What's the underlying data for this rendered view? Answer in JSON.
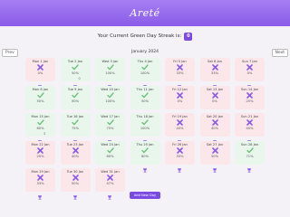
{
  "app": {
    "title": "Areté"
  },
  "streak": {
    "label": "Your Current Green Day Streak is:",
    "count": "0"
  },
  "nav": {
    "prev": "Prev",
    "next": "Next",
    "month": "January 2024"
  },
  "days": [
    {
      "date": "Mon 1 Jan",
      "status": "red",
      "pct": "0%",
      "cup": true,
      "cups": ""
    },
    {
      "date": "Tue 2 Jan",
      "status": "green",
      "pct": "50%",
      "cup": true,
      "cups": "0"
    },
    {
      "date": "Wed 3 Jan",
      "status": "green",
      "pct": "100%",
      "cup": true,
      "cups": ""
    },
    {
      "date": "Thu 4 Jan",
      "status": "green",
      "pct": "100%",
      "cup": true,
      "cups": ""
    },
    {
      "date": "Fri 5 Jan",
      "status": "red",
      "pct": "33%",
      "cup": true,
      "cups": ""
    },
    {
      "date": "Sat 6 Jan",
      "status": "red",
      "pct": "33%",
      "cup": true,
      "cups": ""
    },
    {
      "date": "Sun 7 Jan",
      "status": "red",
      "pct": "0%",
      "cup": true,
      "cups": ""
    },
    {
      "date": "Mon 8 Jan",
      "status": "green",
      "pct": "50%",
      "cup": true,
      "cups": ""
    },
    {
      "date": "Tue 9 Jan",
      "status": "green",
      "pct": "50%",
      "cup": true,
      "cups": ""
    },
    {
      "date": "Wed 10 Jan",
      "status": "green",
      "pct": "100%",
      "cup": true,
      "cups": ""
    },
    {
      "date": "Thu 11 Jan",
      "status": "green",
      "pct": "50%",
      "cup": true,
      "cups": ""
    },
    {
      "date": "Fri 12 Jan",
      "status": "red",
      "pct": "0%",
      "cup": true,
      "cups": ""
    },
    {
      "date": "Sat 13 Jan",
      "status": "red",
      "pct": "0%",
      "cup": true,
      "cups": ""
    },
    {
      "date": "Sun 14 Jan",
      "status": "red",
      "pct": "25%",
      "cup": true,
      "cups": ""
    },
    {
      "date": "Mon 15 Jan",
      "status": "green",
      "pct": "60%",
      "cup": true,
      "cups": "3"
    },
    {
      "date": "Tue 16 Jan",
      "status": "green",
      "pct": "75%",
      "cup": true,
      "cups": ""
    },
    {
      "date": "Wed 17 Jan",
      "status": "green",
      "pct": "75%",
      "cup": true,
      "cups": ""
    },
    {
      "date": "Thu 18 Jan",
      "status": "green",
      "pct": "100%",
      "cup": true,
      "cups": ""
    },
    {
      "date": "Fri 19 Jan",
      "status": "red",
      "pct": "40%",
      "cup": true,
      "cups": ""
    },
    {
      "date": "Sat 20 Jan",
      "status": "red",
      "pct": "40%",
      "cup": true,
      "cups": ""
    },
    {
      "date": "Sun 21 Jan",
      "status": "red",
      "pct": "40%",
      "cup": true,
      "cups": ""
    },
    {
      "date": "Mon 22 Jan",
      "status": "red",
      "pct": "20%",
      "cup": true,
      "cups": ""
    },
    {
      "date": "Tue 23 Jan",
      "status": "red",
      "pct": "40%",
      "cup": true,
      "cups": ""
    },
    {
      "date": "Wed 24 Jan",
      "status": "green",
      "pct": "60%",
      "cup": true,
      "cups": ""
    },
    {
      "date": "Thu 25 Jan",
      "status": "green",
      "pct": "80%",
      "cup": true,
      "cups": ""
    },
    {
      "date": "Fri 26 Jan",
      "status": "red",
      "pct": "33%",
      "cup": true,
      "cups": ""
    },
    {
      "date": "Sat 27 Jan",
      "status": "red",
      "pct": "50%",
      "cup": true,
      "cups": ""
    },
    {
      "date": "Sun 28 Jan",
      "status": "green",
      "pct": "71%",
      "cup": true,
      "cups": ""
    },
    {
      "date": "Mon 29 Jan",
      "status": "red",
      "pct": "33%",
      "cup": true,
      "cups": ""
    },
    {
      "date": "Tue 30 Jan",
      "status": "red",
      "pct": "50%",
      "cup": true,
      "cups": ""
    },
    {
      "date": "Wed 31 Jan",
      "status": "red",
      "pct": "47%",
      "cup": true,
      "cups": ""
    }
  ],
  "add_button": "Add New Day",
  "colors": {
    "accent": "#7b4ae2",
    "header": "#9a6bef",
    "green_cell": "#e8f6ec",
    "red_cell": "#fbe6ea",
    "check": "#6fbf7d",
    "cross": "#8a5ce6"
  },
  "icons": {
    "green_mark": "check-icon",
    "red_mark": "cross-icon",
    "cup": "trophy-icon"
  }
}
